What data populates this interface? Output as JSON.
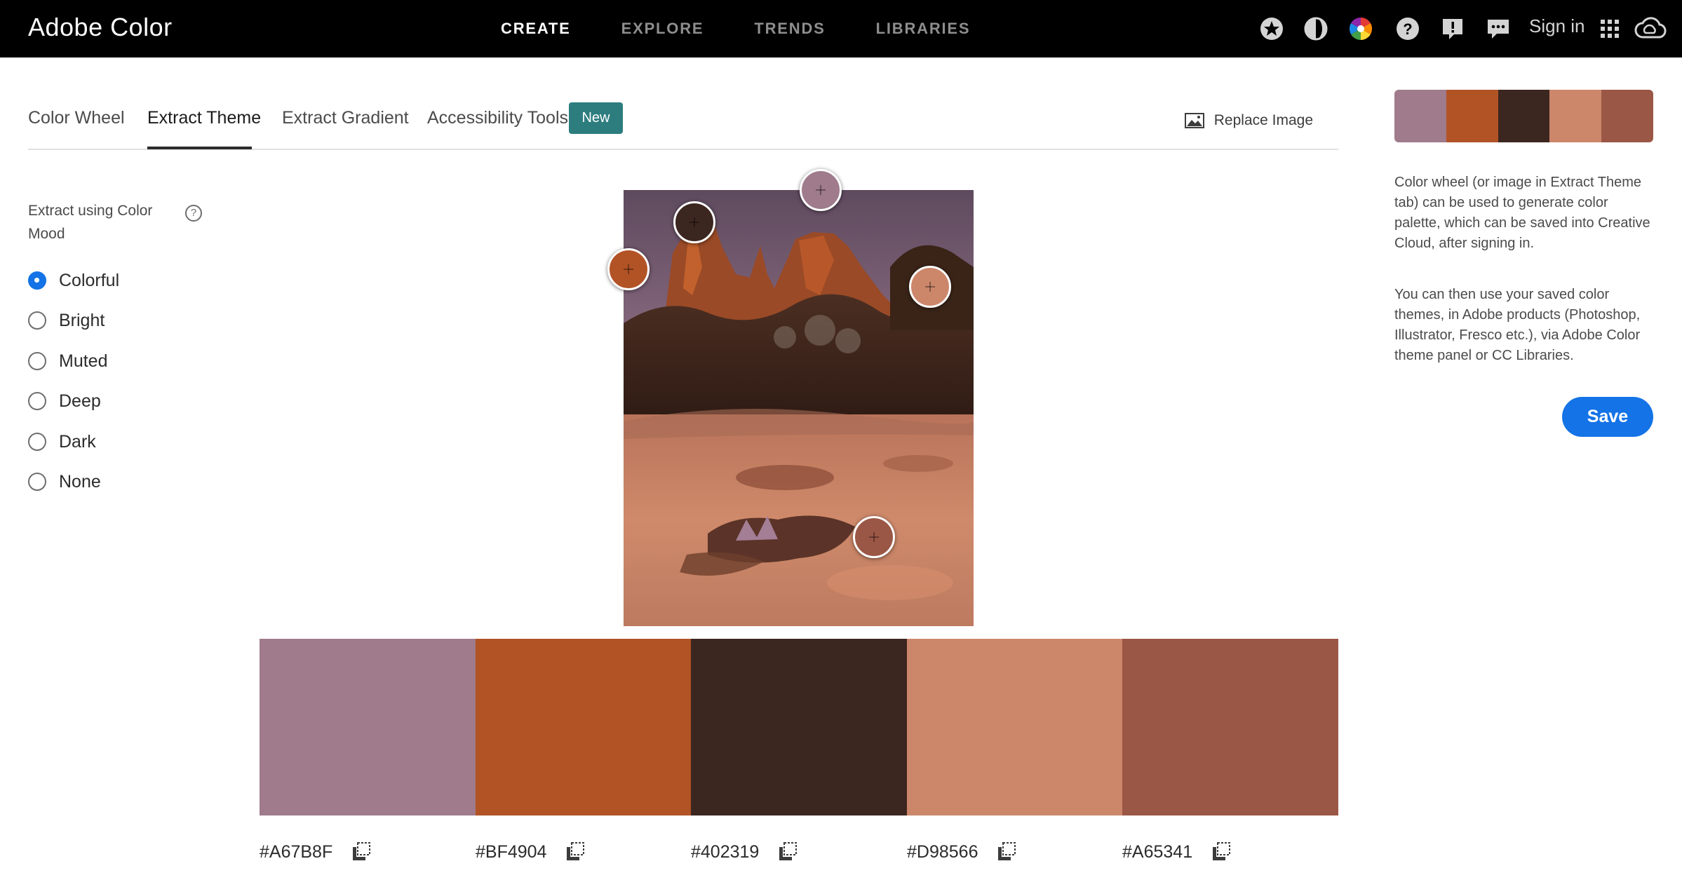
{
  "header": {
    "brand": "Adobe Color",
    "nav": [
      {
        "label": "CREATE",
        "active": true
      },
      {
        "label": "EXPLORE",
        "active": false
      },
      {
        "label": "TRENDS",
        "active": false
      },
      {
        "label": "LIBRARIES",
        "active": false
      }
    ],
    "sign_in": "Sign in",
    "icons": [
      "star-icon",
      "contrast-icon",
      "color-wheel-icon",
      "help-icon",
      "feedback-alert-icon",
      "chat-icon",
      "apps-grid-icon",
      "creative-cloud-icon"
    ]
  },
  "tabs": {
    "items": [
      {
        "label": "Color Wheel",
        "active": false
      },
      {
        "label": "Extract Theme",
        "active": true
      },
      {
        "label": "Extract Gradient",
        "active": false
      },
      {
        "label": "Accessibility Tools",
        "active": false
      }
    ],
    "badge": "New",
    "replace_image": "Replace Image"
  },
  "mood": {
    "label": "Extract using Color Mood",
    "help": "?",
    "options": [
      {
        "label": "Colorful",
        "checked": true
      },
      {
        "label": "Bright",
        "checked": false
      },
      {
        "label": "Muted",
        "checked": false
      },
      {
        "label": "Deep",
        "checked": false
      },
      {
        "label": "Dark",
        "checked": false
      },
      {
        "label": "None",
        "checked": false
      }
    ]
  },
  "palette": [
    {
      "hex": "#A67B8F",
      "color": "#9f7b8c"
    },
    {
      "hex": "#BF4904",
      "color": "#b25326"
    },
    {
      "hex": "#402319",
      "color": "#3c2620"
    },
    {
      "hex": "#D98566",
      "color": "#cc876b"
    },
    {
      "hex": "#A65341",
      "color": "#9b5745"
    }
  ],
  "right_panel": {
    "info_1": "Color wheel (or image in Extract Theme tab) can be used to generate color palette, which can be saved into Creative Cloud, after signing in.",
    "info_2": "You can then use your saved color themes, in Adobe products (Photoshop, Illustrator, Fresco etc.), via Adobe Color theme panel or CC Libraries.",
    "save": "Save"
  },
  "colors": {
    "accent": "#1473e6",
    "badge": "#2d7d7f",
    "header_bg": "#000000"
  }
}
